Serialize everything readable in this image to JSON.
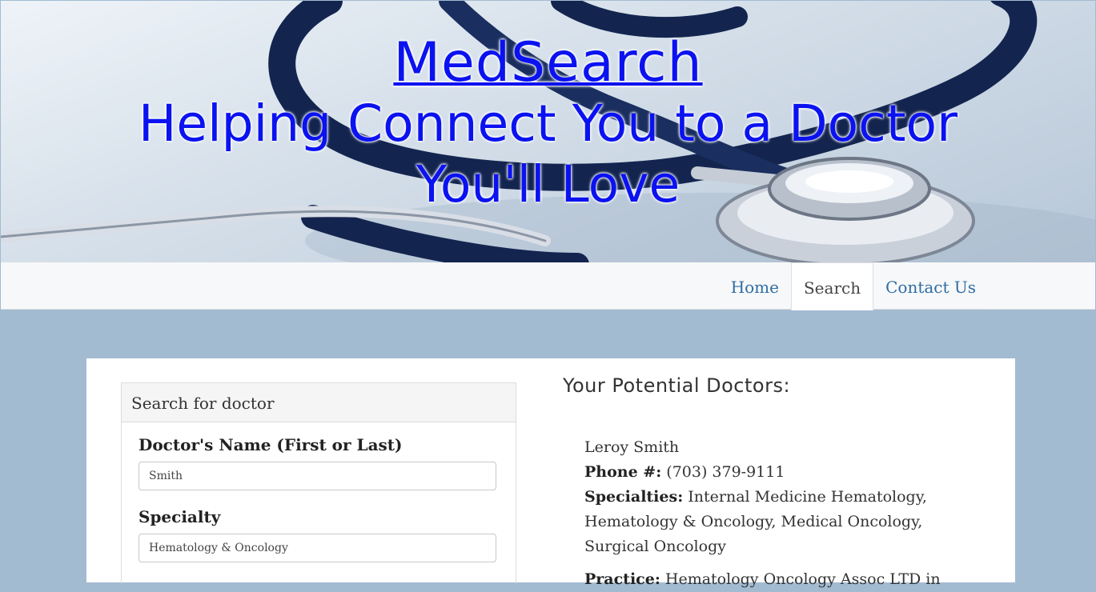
{
  "hero": {
    "brand": "MedSearch",
    "tagline": "Helping Connect You to a Doctor You'll Love"
  },
  "nav": {
    "items": [
      {
        "label": "Home",
        "active": false
      },
      {
        "label": "Search",
        "active": true
      },
      {
        "label": "Contact Us",
        "active": false
      }
    ]
  },
  "search_panel": {
    "heading": "Search for doctor",
    "name_label": "Doctor's Name (First or Last)",
    "name_value": "Smith",
    "specialty_label": "Specialty",
    "specialty_value": "Hematology & Oncology"
  },
  "results": {
    "title": "Your Potential Doctors:",
    "doctors": [
      {
        "name": "Leroy Smith",
        "phone_label": "Phone #:",
        "phone": "(703) 379-9111",
        "specialties_label": "Specialties:",
        "specialties": "Internal Medicine Hematology, Hematology & Oncology, Medical Oncology, Surgical Oncology",
        "practice_label": "Practice:",
        "practice": "Hematology Oncology Assoc LTD in"
      }
    ]
  },
  "colors": {
    "title_blue": "#0b12f0",
    "page_bg": "#a3bbd1",
    "link": "#2e6da4"
  }
}
